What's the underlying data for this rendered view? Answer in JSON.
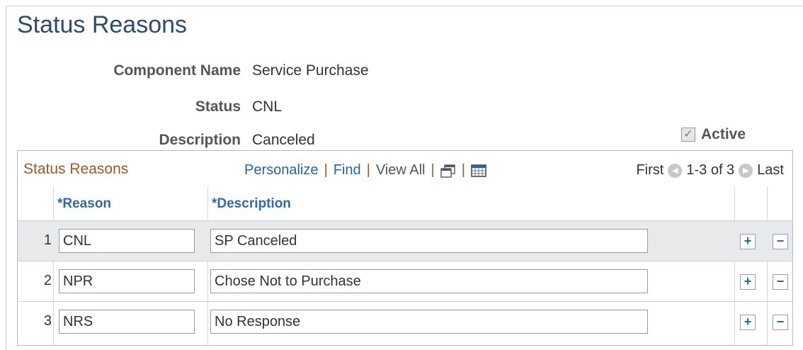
{
  "page": {
    "title": "Status Reasons"
  },
  "fields": {
    "component_name": {
      "label": "Component Name",
      "value": "Service Purchase"
    },
    "status": {
      "label": "Status",
      "value": "CNL"
    },
    "description": {
      "label": "Description",
      "value": "Canceled"
    },
    "active": {
      "label": "Active",
      "checked": true
    }
  },
  "grid": {
    "title": "Status Reasons",
    "toolbar": {
      "personalize": "Personalize",
      "find": "Find",
      "view_all": "View All",
      "separator": "|"
    },
    "pager": {
      "first": "First",
      "range": "1-3 of 3",
      "last": "Last"
    },
    "columns": {
      "reason": "*Reason",
      "description": "*Description"
    },
    "rows": [
      {
        "num": "1",
        "reason": "CNL",
        "description": "SP Canceled"
      },
      {
        "num": "2",
        "reason": "NPR",
        "description": "Chose Not to Purchase"
      },
      {
        "num": "3",
        "reason": "NRS",
        "description": "No Response"
      }
    ],
    "add_label": "+",
    "delete_label": "−"
  }
}
